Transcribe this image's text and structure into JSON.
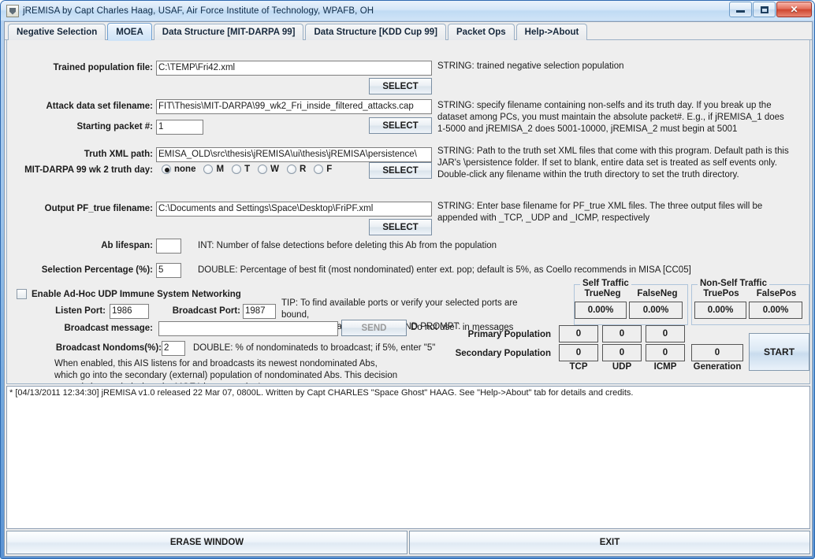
{
  "window": {
    "title": "jREMISA by Capt Charles Haag, USAF, Air Force Institute of Technology, WPAFB, OH",
    "minimize_label": "Minimize",
    "maximize_label": "Maximize",
    "close_label": "✕"
  },
  "tabs": [
    {
      "label": "Negative Selection",
      "active": false
    },
    {
      "label": "MOEA",
      "active": true
    },
    {
      "label": "Data Structure [MIT-DARPA 99]",
      "active": false
    },
    {
      "label": "Data Structure [KDD Cup 99]",
      "active": false
    },
    {
      "label": "Packet Ops",
      "active": false
    },
    {
      "label": "Help->About",
      "active": false
    }
  ],
  "form": {
    "trained_population": {
      "label": "Trained population file:",
      "value": "C:\\TEMP\\Fri42.xml",
      "button": "SELECT",
      "desc": "STRING: trained negative selection population"
    },
    "attack_data": {
      "label": "Attack data set filename:",
      "value": "FIT\\Thesis\\MIT-DARPA\\99_wk2_Fri_inside_filtered_attacks.cap",
      "button": "SELECT",
      "desc": "STRING: specify filename containing non-selfs and its truth day. If you break up the\ndataset among PCs, you must maintain the absolute packet#. E.g., if jREMISA_1 does\n1-5000 and jREMISA_2 does 5001-10000, jREMISA_2 must begin at 5001"
    },
    "starting_packet": {
      "label": "Starting packet #:",
      "value": "1"
    },
    "truth_xml": {
      "label": "Truth XML path:",
      "value": "EMISA_OLD\\src\\thesis\\jREMISA\\ui\\thesis\\jREMISA\\persistence\\",
      "button": "SELECT",
      "desc": "STRING: Path to the truth set XML files that come with this program. Default path is this\nJAR's \\persistence folder. If set to blank, entire data set is treated as self events only.\nDouble-click any filename within the truth directory to set the truth directory."
    },
    "truth_day": {
      "label": "MIT-DARPA 99 wk 2 truth day:",
      "options": [
        {
          "label": "none",
          "selected": true
        },
        {
          "label": "M",
          "selected": false
        },
        {
          "label": "T",
          "selected": false
        },
        {
          "label": "W",
          "selected": false
        },
        {
          "label": "R",
          "selected": false
        },
        {
          "label": "F",
          "selected": false
        }
      ]
    },
    "output_pf": {
      "label": "Output PF_true filename:",
      "value": "C:\\Documents and Settings\\Space\\Desktop\\FriPF.xml",
      "button": "SELECT",
      "desc": "STRING: Enter base filename for PF_true XML files. The three output files will be\nappended with _TCP, _UDP and _ICMP, respectively"
    },
    "ab_lifespan": {
      "label": "Ab lifespan:",
      "value": "",
      "desc": "INT: Number of false detections before deleting this Ab from the population"
    },
    "selection_pct": {
      "label": "Selection Percentage (%):",
      "value": "5",
      "desc": "DOUBLE: Percentage of best fit (most nondominated) enter ext. pop; default is 5%, as Coello recommends in MISA [CC05]"
    }
  },
  "networking": {
    "enable_label": "Enable Ad-Hoc UDP Immune System Networking",
    "enabled": false,
    "listen_port": {
      "label": "Listen Port:",
      "value": "1986"
    },
    "broadcast_port": {
      "label": "Broadcast Port:",
      "value": "1987"
    },
    "broadcast_message": {
      "label": "Broadcast message:",
      "value": ""
    },
    "send_button": "SEND",
    "send_note": "Do not use ` in messages",
    "broadcast_nondoms": {
      "label": "Broadcast Nondoms(%):",
      "value": "2"
    },
    "nondoms_desc": "DOUBLE: % of nondominateds to broadcast; if 5%, enter \"5\"",
    "tip": "TIP: To find available ports or verify your selected ports are bound,\ntype \"netstat -an\" in a COMMAND PROMPT.",
    "explanation": "When enabled, this AIS listens for and broadcasts its newest nondominated Abs,\nwhich go into the secondary (external) population of nondominated Abs. This decision\ncan only be toggled when the MOEA is not running!"
  },
  "stats": {
    "self_traffic": {
      "title": "Self Traffic",
      "columns": [
        "TrueNeg",
        "FalseNeg"
      ],
      "values": [
        "0.00%",
        "0.00%"
      ]
    },
    "nonself_traffic": {
      "title": "Non-Self Traffic",
      "columns": [
        "TruePos",
        "FalsePos"
      ],
      "values": [
        "0.00%",
        "0.00%"
      ]
    },
    "population_rows": [
      {
        "label": "Primary Population",
        "values": [
          "0",
          "0",
          "0"
        ]
      },
      {
        "label": "Secondary Population",
        "values": [
          "0",
          "0",
          "0"
        ]
      }
    ],
    "protocol_columns": [
      "TCP",
      "UDP",
      "ICMP"
    ],
    "generation": {
      "label": "Generation",
      "value": "0"
    },
    "start_button": "START"
  },
  "log": {
    "lines": [
      "* [04/13/2011 12:34:30] jREMISA v1.0 released 22 Mar 07, 0800L. Written by Capt CHARLES \"Space Ghost\" HAAG. See \"Help->About\" tab for details and credits."
    ]
  },
  "footer": {
    "erase_label": "ERASE WINDOW",
    "exit_label": "EXIT"
  }
}
